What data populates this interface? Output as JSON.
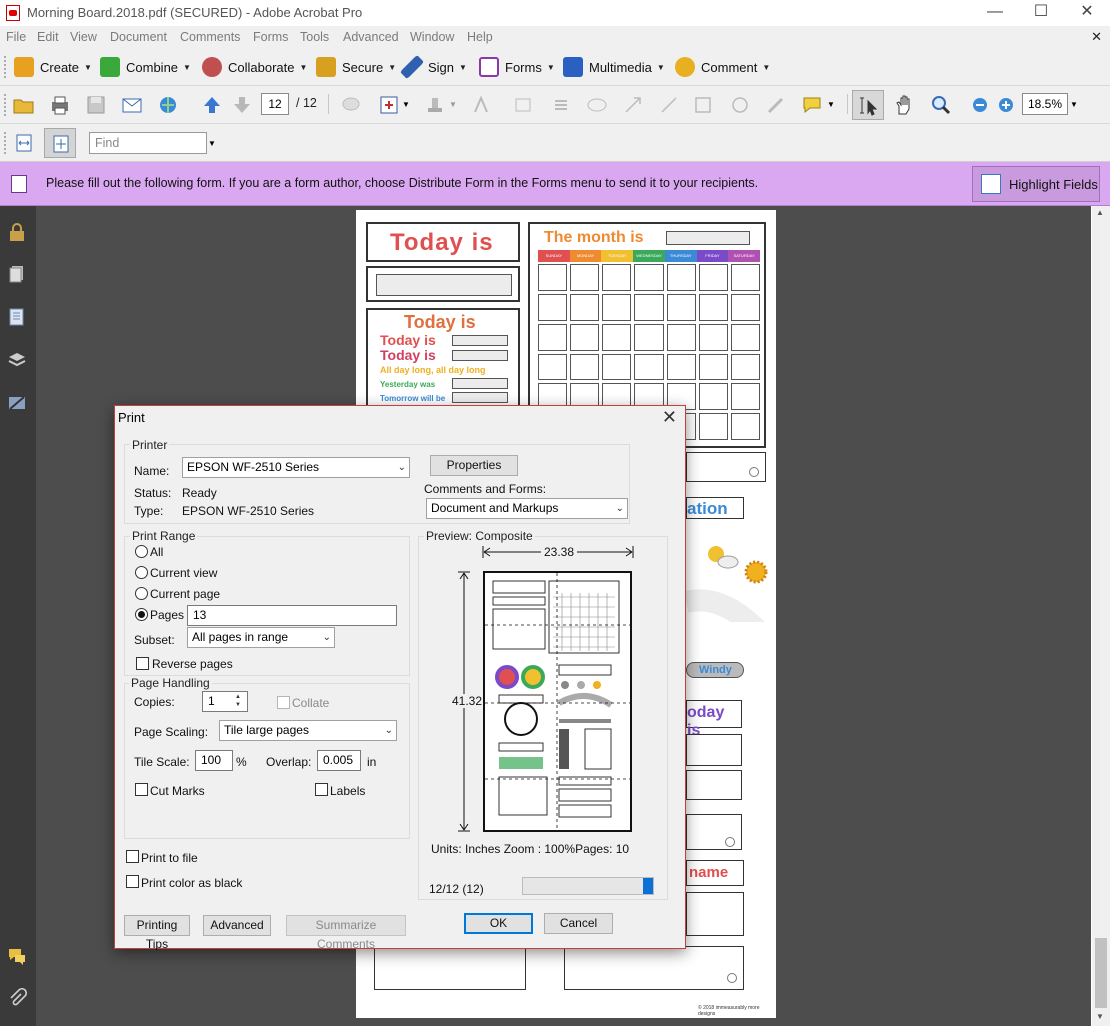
{
  "window": {
    "title": "Morning Board.2018.pdf (SECURED) - Adobe Acrobat Pro",
    "minimize": "—",
    "maximize": "☐",
    "close": "✕"
  },
  "menubar": {
    "items": [
      "File",
      "Edit",
      "View",
      "Document",
      "Comments",
      "Forms",
      "Tools",
      "Advanced",
      "Window",
      "Help"
    ],
    "close_doc": "✕"
  },
  "tasks": {
    "items": [
      {
        "label": "Create",
        "icon": "create-icon",
        "color": "#e8a020"
      },
      {
        "label": "Combine",
        "icon": "combine-icon",
        "color": "#3aa83a"
      },
      {
        "label": "Collaborate",
        "icon": "collaborate-icon",
        "color": "#c05050"
      },
      {
        "label": "Secure",
        "icon": "lock-icon",
        "color": "#d8a020"
      },
      {
        "label": "Sign",
        "icon": "pen-icon",
        "color": "#3060b0"
      },
      {
        "label": "Forms",
        "icon": "forms-icon",
        "color": "#8a3aa8"
      },
      {
        "label": "Multimedia",
        "icon": "multimedia-icon",
        "color": "#2a60c0"
      },
      {
        "label": "Comment",
        "icon": "comment-icon",
        "color": "#e8b020"
      }
    ]
  },
  "toolbar": {
    "page_current": "12",
    "page_total": "/ 12",
    "zoom": "18.5%"
  },
  "findbar": {
    "placeholder": "Find"
  },
  "notice": {
    "message": "Please fill out the following form. If you are a form author, choose Distribute Form in the Forms menu to send it to your recipients.",
    "highlight_button": "Highlight Fields"
  },
  "page": {
    "today_is": "Today is",
    "month_is": "The month is",
    "weekdays": [
      "SUNDAY",
      "MONDAY",
      "TUESDAY",
      "WEDNESDAY",
      "THURSDAY",
      "FRIDAY",
      "SATURDAY"
    ],
    "weekday_colors": [
      "#e05050",
      "#f08a30",
      "#f0c030",
      "#3aaa5a",
      "#3a8ad8",
      "#7a4ac8",
      "#b050b0"
    ],
    "list_today_1": "Today is",
    "list_today_2": "Today is",
    "all_day_long": "All day long, all day long",
    "yesterday_was": "Yesterday was",
    "tomorrow_will_be": "Tomorrow will be",
    "ation": "ation",
    "windy": "Windy",
    "oday_is": "oday is",
    "name": "name",
    "copyright": "© 2018 immeasurably more designs"
  },
  "print_dialog": {
    "title": "Print",
    "printer_group": "Printer",
    "name_label": "Name:",
    "printer_name": "EPSON WF-2510 Series",
    "properties_button": "Properties",
    "status_label": "Status:",
    "status_value": "Ready",
    "type_label": "Type:",
    "type_value": "EPSON WF-2510 Series",
    "comments_forms_label": "Comments and Forms:",
    "comments_forms_value": "Document and Markups",
    "print_range_group": "Print Range",
    "range_all": "All",
    "range_current_view": "Current view",
    "range_current_page": "Current page",
    "range_pages": "Pages",
    "pages_value": "13",
    "subset_label": "Subset:",
    "subset_value": "All pages in range",
    "reverse_pages": "Reverse pages",
    "page_handling_group": "Page Handling",
    "copies_label": "Copies:",
    "copies_value": "1",
    "collate": "Collate",
    "page_scaling_label": "Page Scaling:",
    "page_scaling_value": "Tile large pages",
    "tile_scale_label": "Tile Scale:",
    "tile_scale_value": "100",
    "tile_scale_unit": "%",
    "overlap_label": "Overlap:",
    "overlap_value": "0.005",
    "overlap_unit": "in",
    "cut_marks": "Cut Marks",
    "labels": "Labels",
    "print_to_file": "Print to file",
    "print_color_black": "Print color as black",
    "preview_label": "Preview: Composite",
    "preview_width": "23.38",
    "preview_height": "41.32",
    "units_text": "Units: Inches Zoom : 100%Pages: 10",
    "page_counter": "12/12 (12)",
    "progress_fraction": 0.08,
    "printing_tips_button": "Printing Tips",
    "advanced_button": "Advanced",
    "summarize_button": "Summarize Comments",
    "ok_button": "OK",
    "cancel_button": "Cancel"
  }
}
